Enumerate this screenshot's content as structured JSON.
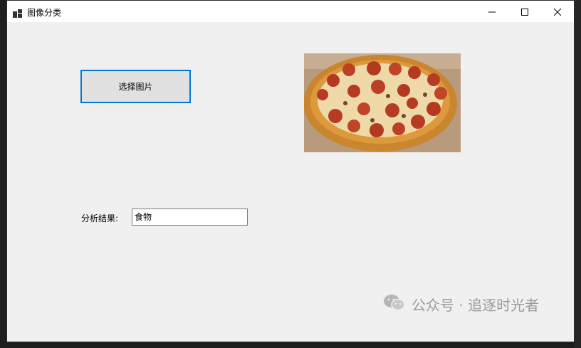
{
  "window": {
    "title": "图像分类",
    "icons": {
      "app": "app-icon",
      "minimize": "minimize-icon",
      "maximize": "maximize-icon",
      "close": "close-icon"
    }
  },
  "form": {
    "select_button_label": "选择图片",
    "result_label": "分析结果:",
    "result_value": "食物"
  },
  "image": {
    "subject": "pizza"
  },
  "watermark": {
    "text": "公众号 · 追逐时光者",
    "icon": "wechat-icon"
  },
  "colors": {
    "accent": "#0078d7",
    "window_bg": "#f0f0f0",
    "titlebar_bg": "#ffffff",
    "button_bg": "#e1e1e1"
  }
}
